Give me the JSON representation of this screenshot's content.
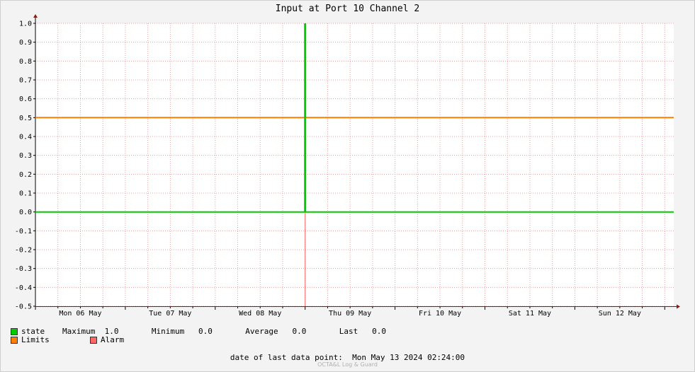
{
  "chart_data": {
    "type": "line",
    "title": "Input at Port 10 Channel 2",
    "ylim": [
      -0.5,
      1.0
    ],
    "yticks": [
      "1.0",
      "0.9",
      "0.8",
      "0.7",
      "0.6",
      "0.5",
      "0.4",
      "0.3",
      "0.2",
      "0.1",
      "0.0",
      "-0.1",
      "-0.2",
      "-0.3",
      "-0.4",
      "-0.5"
    ],
    "xlim": [
      "2024-05-06 00:00",
      "2024-05-13 02:24"
    ],
    "xticks": [
      "Mon 06 May",
      "Tue 07 May",
      "Wed 08 May",
      "Thu 09 May",
      "Fri 10 May",
      "Sat 11 May",
      "Sun 12 May"
    ],
    "grid": true,
    "series": [
      {
        "name": "state",
        "color": "#00cc00",
        "points": [
          [
            "2024-05-06 00:00",
            0
          ],
          [
            "2024-05-09 00:00",
            0
          ],
          [
            "2024-05-09 00:00",
            1.0
          ],
          [
            "2024-05-09 00:00",
            0
          ],
          [
            "2024-05-13 02:24",
            0
          ]
        ]
      },
      {
        "name": "Limits",
        "color": "#ff7f00",
        "points": [
          [
            "2024-05-06 00:00",
            0.5
          ],
          [
            "2024-05-13 02:24",
            0.5
          ]
        ]
      },
      {
        "name": "Alarm",
        "color": "#ff6666",
        "points": [
          [
            "2024-05-09 00:00",
            -0.5
          ],
          [
            "2024-05-09 00:00",
            0.0
          ]
        ]
      }
    ]
  },
  "legend": {
    "state": {
      "label": "state",
      "stats": "Maximum  1.0       Minimum   0.0       Average   0.0       Last   0.0",
      "color": "#00cc00"
    },
    "limits": {
      "label": "Limits",
      "color": "#ff7f00"
    },
    "alarm": {
      "label": "Alarm",
      "color": "#ff6666"
    }
  },
  "footer": {
    "text": "date of last data point:  Mon May 13 2024 02:24:00",
    "watermark": "OCTA&L Log & Guard"
  }
}
